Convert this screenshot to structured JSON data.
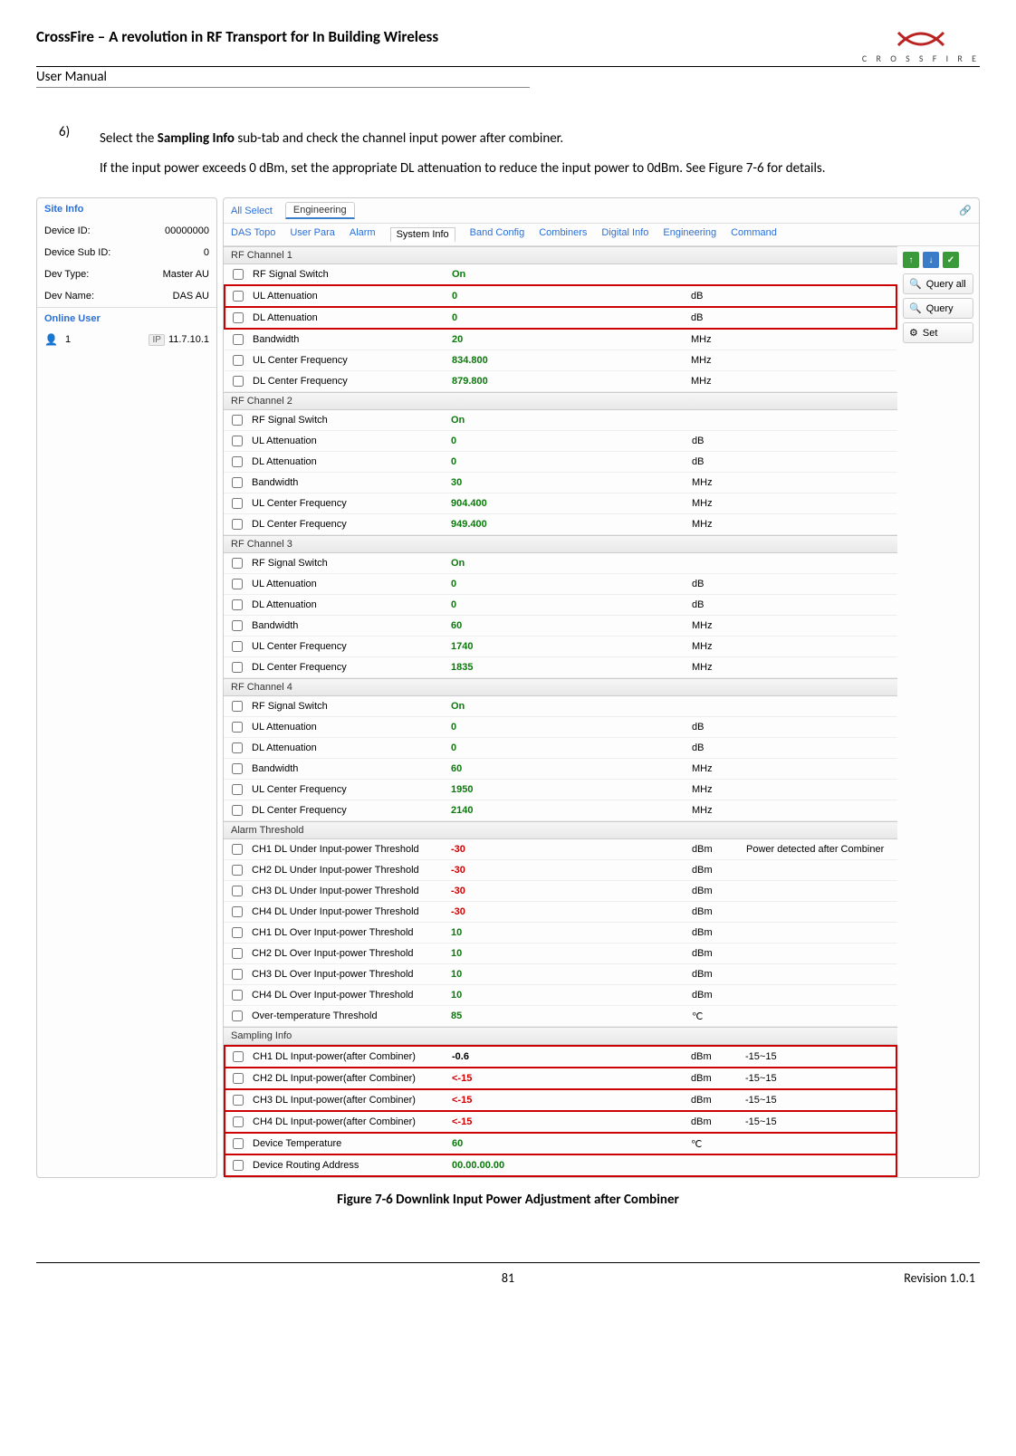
{
  "header": {
    "title": "CrossFire – A revolution in RF Transport for In Building Wireless",
    "subtitle": "User Manual",
    "brand": "C R O S S F I R E"
  },
  "step": {
    "num": "6)",
    "line1_a": "Select the ",
    "line1_bold": "Sampling Info",
    "line1_b": " sub-tab and check the channel input power after combiner.",
    "line2": "If the input power exceeds 0 dBm, set the appropriate DL attenuation to reduce the input power to 0dBm. See Figure 7-6 for details."
  },
  "sidebar": {
    "site_info_head": "Site Info",
    "rows": [
      {
        "label": "Device ID:",
        "value": "00000000"
      },
      {
        "label": "Device Sub ID:",
        "value": "0"
      },
      {
        "label": "Dev Type:",
        "value": "Master AU"
      },
      {
        "label": "Dev Name:",
        "value": "DAS AU"
      }
    ],
    "online_head": "Online User",
    "user_num": "1",
    "ip_label": "IP",
    "ip_value": "11.7.10.1"
  },
  "tabs_top": {
    "all_select": "All Select",
    "active": "Engineering"
  },
  "subtabs": [
    "DAS Topo",
    "User Para",
    "Alarm",
    "System Info",
    "Band Config",
    "Combiners",
    "Digital Info",
    "Engineering",
    "Command"
  ],
  "subtab_active_index": 3,
  "actions": {
    "query_all": "Query all",
    "query": "Query",
    "set": "Set"
  },
  "sections": [
    {
      "head": "RF Channel 1",
      "hl": "atten",
      "rows": [
        {
          "label": "RF Signal Switch",
          "value": "On",
          "cls": "val-green",
          "unit": ""
        },
        {
          "label": "UL Attenuation",
          "value": "0",
          "cls": "val-green",
          "unit": "dB"
        },
        {
          "label": "DL Attenuation",
          "value": "0",
          "cls": "val-green",
          "unit": "dB"
        },
        {
          "label": "Bandwidth",
          "value": "20",
          "cls": "val-green",
          "unit": "MHz"
        },
        {
          "label": "UL Center Frequency",
          "value": "834.800",
          "cls": "val-green",
          "unit": "MHz"
        },
        {
          "label": "DL Center Frequency",
          "value": "879.800",
          "cls": "val-green",
          "unit": "MHz"
        }
      ]
    },
    {
      "head": "RF Channel 2",
      "rows": [
        {
          "label": "RF Signal Switch",
          "value": "On",
          "cls": "val-green",
          "unit": ""
        },
        {
          "label": "UL Attenuation",
          "value": "0",
          "cls": "val-green",
          "unit": "dB"
        },
        {
          "label": "DL Attenuation",
          "value": "0",
          "cls": "val-green",
          "unit": "dB"
        },
        {
          "label": "Bandwidth",
          "value": "30",
          "cls": "val-green",
          "unit": "MHz"
        },
        {
          "label": "UL Center Frequency",
          "value": "904.400",
          "cls": "val-green",
          "unit": "MHz"
        },
        {
          "label": "DL Center Frequency",
          "value": "949.400",
          "cls": "val-green",
          "unit": "MHz"
        }
      ]
    },
    {
      "head": "RF Channel 3",
      "rows": [
        {
          "label": "RF Signal Switch",
          "value": "On",
          "cls": "val-green",
          "unit": ""
        },
        {
          "label": "UL Attenuation",
          "value": "0",
          "cls": "val-green",
          "unit": "dB"
        },
        {
          "label": "DL Attenuation",
          "value": "0",
          "cls": "val-green",
          "unit": "dB"
        },
        {
          "label": "Bandwidth",
          "value": "60",
          "cls": "val-green",
          "unit": "MHz"
        },
        {
          "label": "UL Center Frequency",
          "value": "1740",
          "cls": "val-green",
          "unit": "MHz"
        },
        {
          "label": "DL Center Frequency",
          "value": "1835",
          "cls": "val-green",
          "unit": "MHz"
        }
      ]
    },
    {
      "head": "RF Channel 4",
      "rows": [
        {
          "label": "RF Signal Switch",
          "value": "On",
          "cls": "val-green",
          "unit": ""
        },
        {
          "label": "UL Attenuation",
          "value": "0",
          "cls": "val-green",
          "unit": "dB"
        },
        {
          "label": "DL Attenuation",
          "value": "0",
          "cls": "val-green",
          "unit": "dB"
        },
        {
          "label": "Bandwidth",
          "value": "60",
          "cls": "val-green",
          "unit": "MHz"
        },
        {
          "label": "UL Center Frequency",
          "value": "1950",
          "cls": "val-green",
          "unit": "MHz"
        },
        {
          "label": "DL Center Frequency",
          "value": "2140",
          "cls": "val-green",
          "unit": "MHz"
        }
      ]
    },
    {
      "head": "Alarm Threshold",
      "rows": [
        {
          "label": "CH1 DL Under Input-power Threshold",
          "value": "-30",
          "cls": "val-red",
          "unit": "dBm",
          "note": "Power detected after Combiner"
        },
        {
          "label": "CH2 DL Under Input-power Threshold",
          "value": "-30",
          "cls": "val-red",
          "unit": "dBm"
        },
        {
          "label": "CH3 DL Under Input-power Threshold",
          "value": "-30",
          "cls": "val-red",
          "unit": "dBm"
        },
        {
          "label": "CH4 DL Under Input-power Threshold",
          "value": "-30",
          "cls": "val-red",
          "unit": "dBm"
        },
        {
          "label": "CH1 DL Over Input-power Threshold",
          "value": "10",
          "cls": "val-green",
          "unit": "dBm"
        },
        {
          "label": "CH2 DL Over Input-power Threshold",
          "value": "10",
          "cls": "val-green",
          "unit": "dBm"
        },
        {
          "label": "CH3 DL Over Input-power Threshold",
          "value": "10",
          "cls": "val-green",
          "unit": "dBm"
        },
        {
          "label": "CH4 DL Over Input-power Threshold",
          "value": "10",
          "cls": "val-green",
          "unit": "dBm"
        },
        {
          "label": "Over-temperature Threshold",
          "value": "85",
          "cls": "val-green",
          "unit": "℃"
        }
      ]
    },
    {
      "head": "Sampling Info",
      "hl": "all",
      "rows": [
        {
          "label": "CH1 DL Input-power(after Combiner)",
          "value": "-0.6",
          "cls": "val-black",
          "unit": "dBm",
          "note": "-15~15"
        },
        {
          "label": "CH2 DL Input-power(after Combiner)",
          "value": "<-15",
          "cls": "val-red",
          "unit": "dBm",
          "note": "-15~15"
        },
        {
          "label": "CH3 DL Input-power(after Combiner)",
          "value": "<-15",
          "cls": "val-red",
          "unit": "dBm",
          "note": "-15~15"
        },
        {
          "label": "CH4 DL Input-power(after Combiner)",
          "value": "<-15",
          "cls": "val-red",
          "unit": "dBm",
          "note": "-15~15"
        },
        {
          "label": "Device Temperature",
          "value": "60",
          "cls": "val-green",
          "unit": "℃"
        },
        {
          "label": "Device Routing Address",
          "value": "00.00.00.00",
          "cls": "val-green",
          "unit": ""
        }
      ]
    }
  ],
  "caption": "Figure 7-6 Downlink Input Power Adjustment after Combiner",
  "footer": {
    "page": "81",
    "rev": "Revision 1.0.1"
  }
}
